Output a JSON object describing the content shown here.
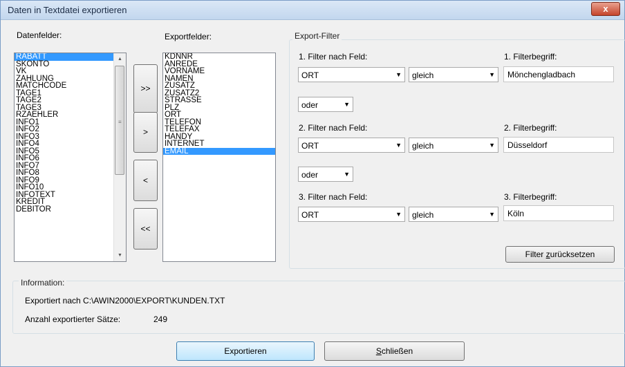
{
  "window": {
    "title": "Daten in Textdatei exportieren",
    "close_symbol": "x"
  },
  "left": {
    "datenfelder_label": "Datenfelder:",
    "exportfelder_label": "Exportfelder:",
    "datenfelder": [
      "RABATT",
      "SKONTO",
      "VK",
      "ZAHLUNG",
      "MATCHCODE",
      "TAGE1",
      "TAGE2",
      "TAGE3",
      "RZAEHLER",
      "INFO1",
      "INFO2",
      "INFO3",
      "INFO4",
      "INFO5",
      "INFO6",
      "INFO7",
      "INFO8",
      "INFO9",
      "INFO10",
      "INFOTEXT",
      "KREDIT",
      "DEBITOR"
    ],
    "datenfelder_selected": "RABATT",
    "exportfelder": [
      "KDNNR",
      "ANREDE",
      "VORNAME",
      "NAMEN",
      "ZUSATZ",
      "ZUSATZ2",
      "STRASSE",
      "PLZ",
      "ORT",
      "TELEFON",
      "TELEFAX",
      "HANDY",
      "INTERNET",
      "EMAIL"
    ],
    "exportfelder_selected": "EMAIL",
    "buttons": {
      "add_all": ">>",
      "add": ">",
      "remove": "<",
      "remove_all": "<<"
    }
  },
  "filter": {
    "group_title": "Export-Filter",
    "f1": {
      "field_label": "1. Filter nach Feld:",
      "term_label": "1. Filterbegriff:",
      "field": "ORT",
      "op": "gleich",
      "term": "Mönchengladbach"
    },
    "logic1": "oder",
    "f2": {
      "field_label": "2. Filter nach Feld:",
      "term_label": "2. Filterbegriff:",
      "field": "ORT",
      "op": "gleich",
      "term": "Düsseldorf"
    },
    "logic2": "oder",
    "f3": {
      "field_label": "3. Filter nach Feld:",
      "term_label": "3. Filterbegriff:",
      "field": "ORT",
      "op": "gleich",
      "term": "Köln"
    },
    "reset_label_pre": "Filter ",
    "reset_label_u": "z",
    "reset_label_post": "urücksetzen"
  },
  "info": {
    "group_title": "Information:",
    "exported_to": "Exportiert nach C:\\AWIN2000\\EXPORT\\KUNDEN.TXT",
    "count_label": "Anzahl exportierter Sätze:",
    "count_value": "249"
  },
  "footer": {
    "export_label": "Exportieren",
    "close_label_u": "S",
    "close_label_rest": "chließen"
  },
  "colors": {
    "selection": "#3399ff",
    "dialog_bg": "#f0f0f0"
  }
}
